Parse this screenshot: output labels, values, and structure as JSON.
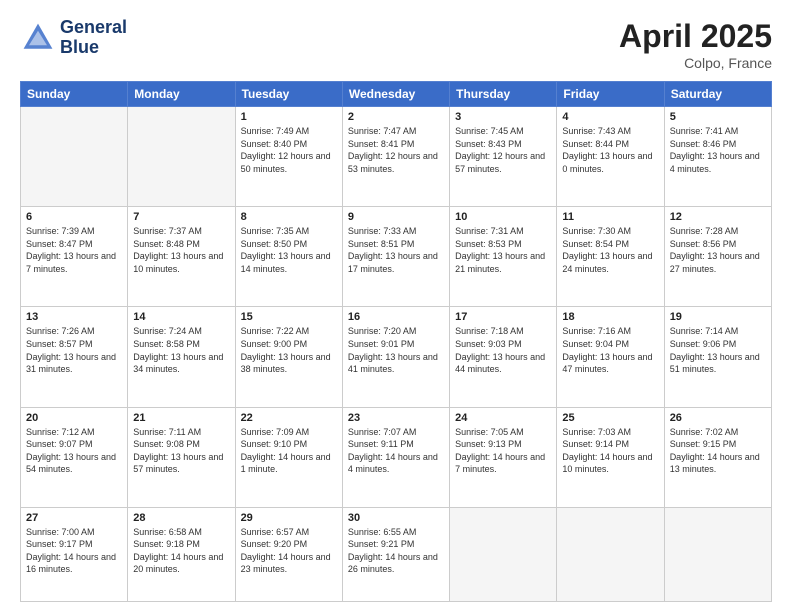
{
  "header": {
    "logo_line1": "General",
    "logo_line2": "Blue",
    "title": "April 2025",
    "subtitle": "Colpo, France"
  },
  "weekdays": [
    "Sunday",
    "Monday",
    "Tuesday",
    "Wednesday",
    "Thursday",
    "Friday",
    "Saturday"
  ],
  "weeks": [
    [
      {
        "day": "",
        "info": ""
      },
      {
        "day": "",
        "info": ""
      },
      {
        "day": "1",
        "info": "Sunrise: 7:49 AM\nSunset: 8:40 PM\nDaylight: 12 hours and 50 minutes."
      },
      {
        "day": "2",
        "info": "Sunrise: 7:47 AM\nSunset: 8:41 PM\nDaylight: 12 hours and 53 minutes."
      },
      {
        "day": "3",
        "info": "Sunrise: 7:45 AM\nSunset: 8:43 PM\nDaylight: 12 hours and 57 minutes."
      },
      {
        "day": "4",
        "info": "Sunrise: 7:43 AM\nSunset: 8:44 PM\nDaylight: 13 hours and 0 minutes."
      },
      {
        "day": "5",
        "info": "Sunrise: 7:41 AM\nSunset: 8:46 PM\nDaylight: 13 hours and 4 minutes."
      }
    ],
    [
      {
        "day": "6",
        "info": "Sunrise: 7:39 AM\nSunset: 8:47 PM\nDaylight: 13 hours and 7 minutes."
      },
      {
        "day": "7",
        "info": "Sunrise: 7:37 AM\nSunset: 8:48 PM\nDaylight: 13 hours and 10 minutes."
      },
      {
        "day": "8",
        "info": "Sunrise: 7:35 AM\nSunset: 8:50 PM\nDaylight: 13 hours and 14 minutes."
      },
      {
        "day": "9",
        "info": "Sunrise: 7:33 AM\nSunset: 8:51 PM\nDaylight: 13 hours and 17 minutes."
      },
      {
        "day": "10",
        "info": "Sunrise: 7:31 AM\nSunset: 8:53 PM\nDaylight: 13 hours and 21 minutes."
      },
      {
        "day": "11",
        "info": "Sunrise: 7:30 AM\nSunset: 8:54 PM\nDaylight: 13 hours and 24 minutes."
      },
      {
        "day": "12",
        "info": "Sunrise: 7:28 AM\nSunset: 8:56 PM\nDaylight: 13 hours and 27 minutes."
      }
    ],
    [
      {
        "day": "13",
        "info": "Sunrise: 7:26 AM\nSunset: 8:57 PM\nDaylight: 13 hours and 31 minutes."
      },
      {
        "day": "14",
        "info": "Sunrise: 7:24 AM\nSunset: 8:58 PM\nDaylight: 13 hours and 34 minutes."
      },
      {
        "day": "15",
        "info": "Sunrise: 7:22 AM\nSunset: 9:00 PM\nDaylight: 13 hours and 38 minutes."
      },
      {
        "day": "16",
        "info": "Sunrise: 7:20 AM\nSunset: 9:01 PM\nDaylight: 13 hours and 41 minutes."
      },
      {
        "day": "17",
        "info": "Sunrise: 7:18 AM\nSunset: 9:03 PM\nDaylight: 13 hours and 44 minutes."
      },
      {
        "day": "18",
        "info": "Sunrise: 7:16 AM\nSunset: 9:04 PM\nDaylight: 13 hours and 47 minutes."
      },
      {
        "day": "19",
        "info": "Sunrise: 7:14 AM\nSunset: 9:06 PM\nDaylight: 13 hours and 51 minutes."
      }
    ],
    [
      {
        "day": "20",
        "info": "Sunrise: 7:12 AM\nSunset: 9:07 PM\nDaylight: 13 hours and 54 minutes."
      },
      {
        "day": "21",
        "info": "Sunrise: 7:11 AM\nSunset: 9:08 PM\nDaylight: 13 hours and 57 minutes."
      },
      {
        "day": "22",
        "info": "Sunrise: 7:09 AM\nSunset: 9:10 PM\nDaylight: 14 hours and 1 minute."
      },
      {
        "day": "23",
        "info": "Sunrise: 7:07 AM\nSunset: 9:11 PM\nDaylight: 14 hours and 4 minutes."
      },
      {
        "day": "24",
        "info": "Sunrise: 7:05 AM\nSunset: 9:13 PM\nDaylight: 14 hours and 7 minutes."
      },
      {
        "day": "25",
        "info": "Sunrise: 7:03 AM\nSunset: 9:14 PM\nDaylight: 14 hours and 10 minutes."
      },
      {
        "day": "26",
        "info": "Sunrise: 7:02 AM\nSunset: 9:15 PM\nDaylight: 14 hours and 13 minutes."
      }
    ],
    [
      {
        "day": "27",
        "info": "Sunrise: 7:00 AM\nSunset: 9:17 PM\nDaylight: 14 hours and 16 minutes."
      },
      {
        "day": "28",
        "info": "Sunrise: 6:58 AM\nSunset: 9:18 PM\nDaylight: 14 hours and 20 minutes."
      },
      {
        "day": "29",
        "info": "Sunrise: 6:57 AM\nSunset: 9:20 PM\nDaylight: 14 hours and 23 minutes."
      },
      {
        "day": "30",
        "info": "Sunrise: 6:55 AM\nSunset: 9:21 PM\nDaylight: 14 hours and 26 minutes."
      },
      {
        "day": "",
        "info": ""
      },
      {
        "day": "",
        "info": ""
      },
      {
        "day": "",
        "info": ""
      }
    ]
  ]
}
